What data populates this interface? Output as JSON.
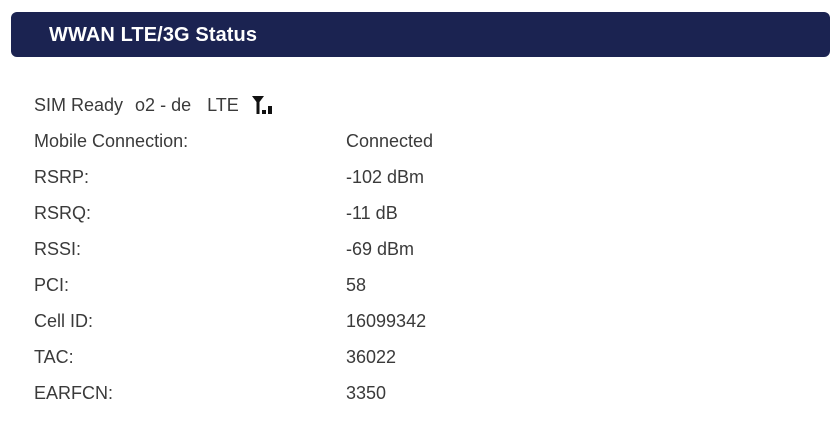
{
  "header": {
    "title": "WWAN LTE/3G Status"
  },
  "status": {
    "sim": "SIM Ready",
    "operator": "o2 - de",
    "technology": "LTE",
    "signal_icon": "signal-strength-icon",
    "signal_bars_lit": 2,
    "signal_bars_total": 4
  },
  "rows": [
    {
      "label": "Mobile Connection:",
      "value": "Connected"
    },
    {
      "label": "RSRP:",
      "value": "-102 dBm"
    },
    {
      "label": "RSRQ:",
      "value": "-11 dB"
    },
    {
      "label": "RSSI:",
      "value": "-69 dBm"
    },
    {
      "label": "PCI:",
      "value": "58"
    },
    {
      "label": "Cell ID:",
      "value": "16099342"
    },
    {
      "label": "TAC:",
      "value": "36022"
    },
    {
      "label": "EARFCN:",
      "value": "3350"
    }
  ],
  "colors": {
    "header_bg": "#1b2351",
    "header_text": "#ffffff",
    "text": "#3a3a3a"
  }
}
